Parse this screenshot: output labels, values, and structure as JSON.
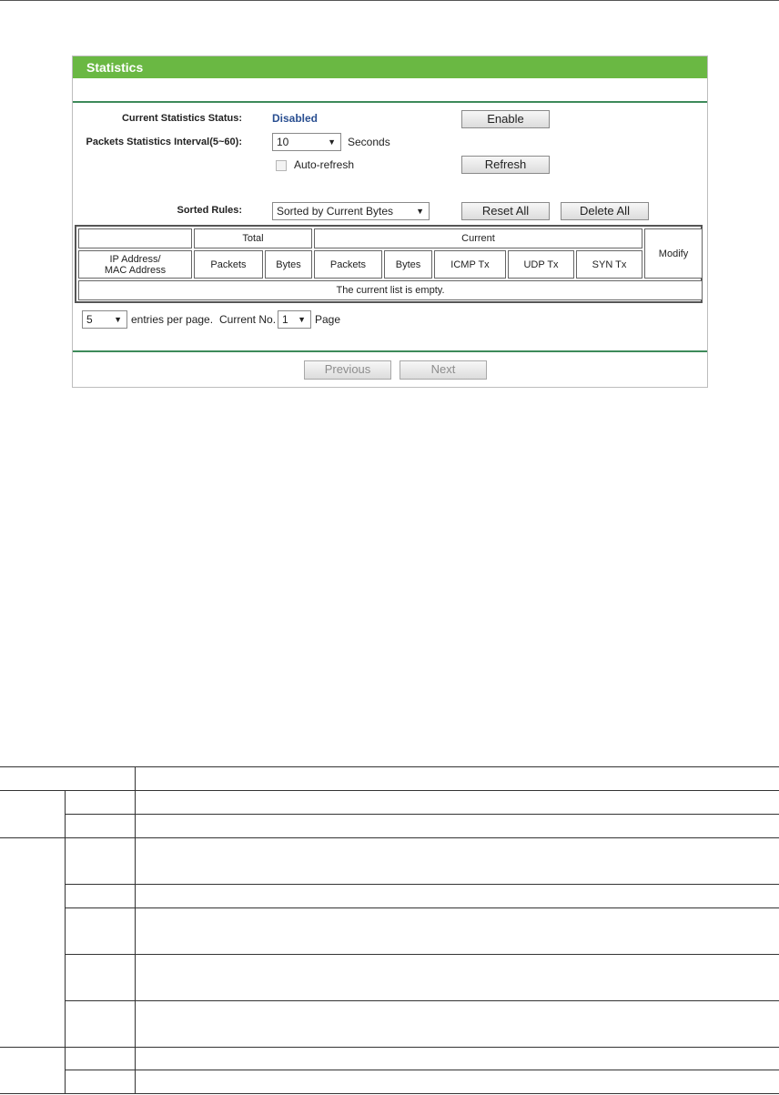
{
  "panel": {
    "title": "Statistics",
    "status_label": "Current Statistics Status:",
    "status_value": "Disabled",
    "interval_label": "Packets Statistics Interval(5~60):",
    "interval_value": "10",
    "interval_unit": "Seconds",
    "autorefresh_label": "Auto-refresh",
    "autorefresh_checked": false,
    "sorted_label": "Sorted Rules:",
    "sorted_value": "Sorted by Current Bytes",
    "buttons": {
      "enable": "Enable",
      "refresh": "Refresh",
      "reset_all": "Reset All",
      "delete_all": "Delete All",
      "previous": "Previous",
      "next": "Next"
    },
    "table": {
      "group_total": "Total",
      "group_current": "Current",
      "col_modify": "Modify",
      "col_ip": "IP Address/",
      "col_mac": "MAC Address",
      "col_total_packets": "Packets",
      "col_total_bytes": "Bytes",
      "col_cur_packets": "Packets",
      "col_cur_bytes": "Bytes",
      "col_icmp": "ICMP Tx",
      "col_udp": "UDP Tx",
      "col_syn": "SYN Tx",
      "empty_message": "The current list is empty."
    },
    "pagination": {
      "entries_value": "5",
      "entries_label": "entries per page.",
      "current_label": "Current No.",
      "current_value": "1",
      "page_label": "Page"
    }
  },
  "colors": {
    "header_green": "#6ab843",
    "divider_green": "#3d8a5a",
    "status_blue": "#2a4f91"
  }
}
